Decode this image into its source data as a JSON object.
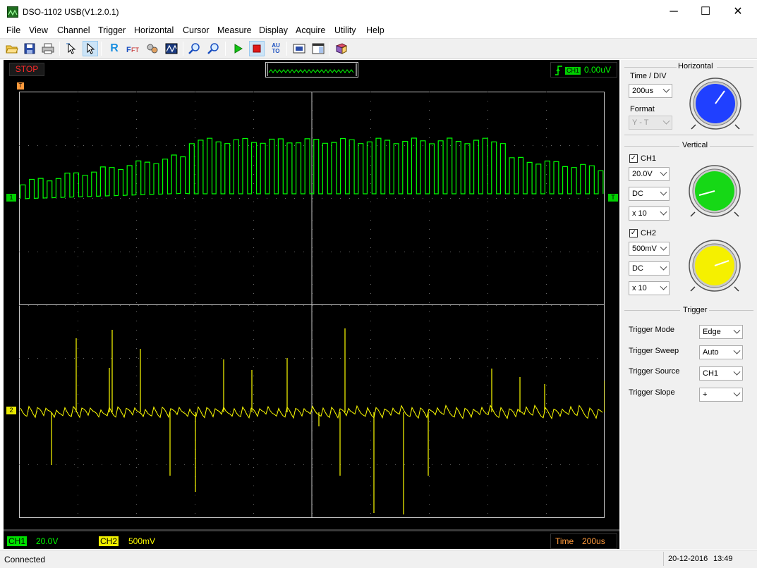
{
  "window": {
    "title": "DSO-1102 USB(V1.2.0.1)",
    "minimize": "─",
    "maximize": "☐",
    "close": "✕"
  },
  "menu": [
    "File",
    "View",
    "Channel",
    "Trigger",
    "Horizontal",
    "Cursor",
    "Measure",
    "Display",
    "Acquire",
    "Utility",
    "Help"
  ],
  "toolbar": {
    "icons": [
      "open-icon",
      "save-icon",
      "print-icon",
      "select-cursor-icon",
      "pointer-icon",
      "reference-icon",
      "fft-icon",
      "math-icon",
      "wave-record-icon",
      "zoom-in-icon",
      "zoom-out-icon",
      "run-icon",
      "stop-icon",
      "auto-icon",
      "snapshot-icon",
      "window-icon",
      "book-icon"
    ],
    "r_label": "R",
    "auto_label": "AU TO"
  },
  "scope": {
    "status": "STOP",
    "trigger_channel": "CH1",
    "trigger_level": "0.00uV",
    "t_marker": "T",
    "ch1_marker": "1",
    "ch2_marker": "2",
    "trigger_marker": "T",
    "ch1_color": "#00ff00",
    "ch2_color": "#ffff00",
    "grid_color": "#c8c8c8"
  },
  "bottom": {
    "ch1_label": "CH1",
    "ch1_scale": "20.0V",
    "ch2_label": "CH2",
    "ch2_scale": "500mV",
    "time_label": "Time",
    "time_value": "200us"
  },
  "panel": {
    "horizontal": {
      "title": "Horizontal",
      "time_div_label": "Time / DIV",
      "time_div_value": "200us",
      "format_label": "Format",
      "format_value": "Y - T",
      "knob_color": "#2040ff"
    },
    "vertical": {
      "title": "Vertical",
      "ch1_label": "CH1",
      "ch1_volts": "20.0V",
      "ch1_coupling": "DC",
      "ch1_probe": "x 10",
      "ch1_knob_color": "#16d816",
      "ch2_label": "CH2",
      "ch2_volts": "500mV",
      "ch2_coupling": "DC",
      "ch2_probe": "x 10",
      "ch2_knob_color": "#f5f000"
    },
    "trigger": {
      "title": "Trigger",
      "mode_label": "Trigger Mode",
      "mode_value": "Edge",
      "sweep_label": "Trigger Sweep",
      "sweep_value": "Auto",
      "source_label": "Trigger Source",
      "source_value": "CH1",
      "slope_label": "Trigger Slope",
      "slope_value": "+"
    }
  },
  "status": {
    "left": "Connected",
    "date": "20-12-2016",
    "time": "13:49"
  }
}
